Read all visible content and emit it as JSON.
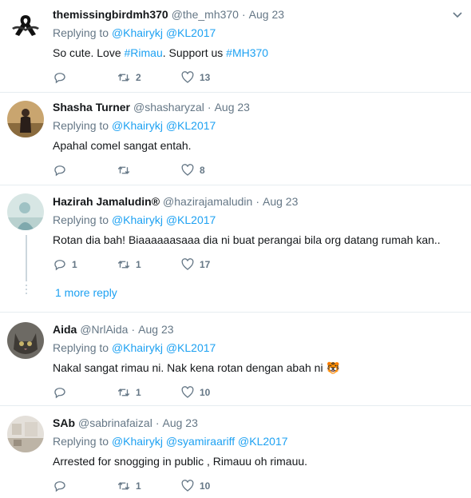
{
  "tweets": [
    {
      "name": "themissingbirdmh370",
      "handle": "@the_mh370",
      "date": "Aug 23",
      "replying_prefix": "Replying to",
      "mentions": [
        "@Khairykj",
        "@KL2017"
      ],
      "text_parts": [
        "So cute. Love ",
        "#Rimau",
        ". Support us ",
        "#MH370"
      ],
      "reply_count": "",
      "retweet_count": "2",
      "like_count": "13"
    },
    {
      "name": "Shasha Turner",
      "handle": "@shasharyzal",
      "date": "Aug 23",
      "replying_prefix": "Replying to",
      "mentions": [
        "@Khairykj",
        "@KL2017"
      ],
      "text": "Apahal comel sangat entah.",
      "reply_count": "",
      "retweet_count": "",
      "like_count": "8"
    },
    {
      "name": "Hazirah Jamaludin®",
      "handle": "@hazirajamaludin",
      "date": "Aug 23",
      "replying_prefix": "Replying to",
      "mentions": [
        "@Khairykj",
        "@KL2017"
      ],
      "text": "Rotan dia bah! Biaaaaaasaaa dia ni buat perangai bila org datang rumah kan..",
      "reply_count": "1",
      "retweet_count": "1",
      "like_count": "17",
      "more_reply": "1 more reply"
    },
    {
      "name": "Aida",
      "handle": "@NrlAida",
      "date": "Aug 23",
      "replying_prefix": "Replying to",
      "mentions": [
        "@Khairykj",
        "@KL2017"
      ],
      "text": "Nakal sangat rimau ni. Nak kena rotan dengan abah ni",
      "emoji": "🐯",
      "reply_count": "",
      "retweet_count": "1",
      "like_count": "10"
    },
    {
      "name": "SAb",
      "handle": "@sabrinafaizal",
      "date": "Aug 23",
      "replying_prefix": "Replying to",
      "mentions": [
        "@Khairykj",
        "@syamiraariff",
        "@KL2017"
      ],
      "text": "Arrested for snogging in public , Rimauu oh rimauu.",
      "reply_count": "",
      "retweet_count": "1",
      "like_count": "10"
    }
  ],
  "colors": {
    "link": "#1da1f2",
    "muted": "#657786",
    "text": "#14171a",
    "divider": "#e6ecf0"
  },
  "icons": [
    "reply-icon",
    "retweet-icon",
    "like-icon",
    "chevron-down-icon"
  ]
}
